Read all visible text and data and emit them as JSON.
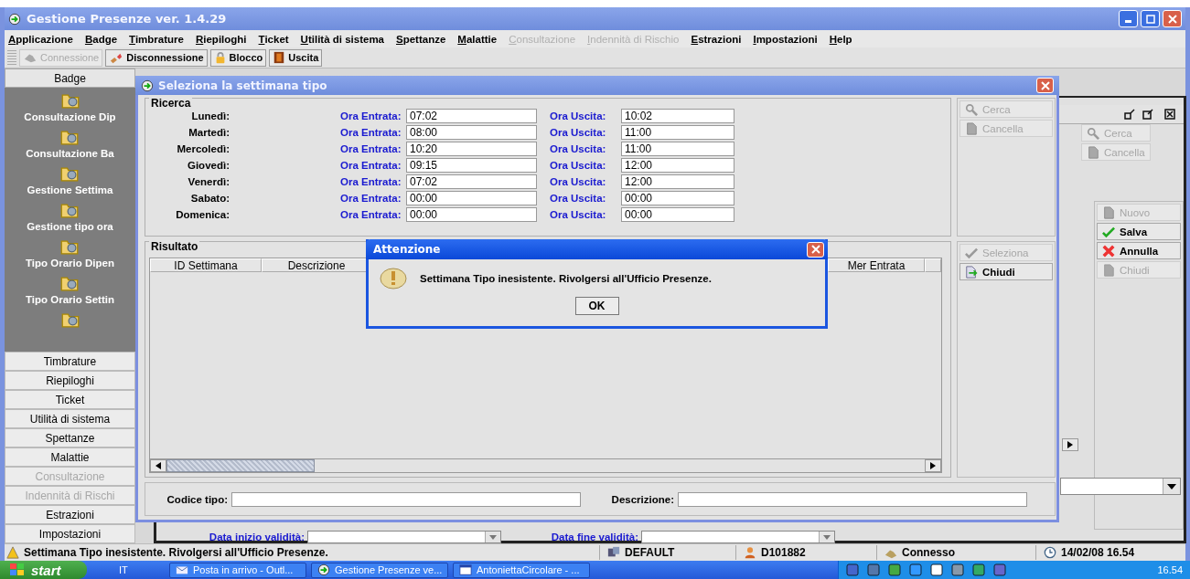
{
  "window": {
    "title": "Gestione Presenze ver. 1.4.29"
  },
  "menu": [
    {
      "label": "Applicazione",
      "disabled": false
    },
    {
      "label": "Badge",
      "disabled": false
    },
    {
      "label": "Timbrature",
      "disabled": false
    },
    {
      "label": "Riepiloghi",
      "disabled": false
    },
    {
      "label": "Ticket",
      "disabled": false
    },
    {
      "label": "Utilità di sistema",
      "disabled": false
    },
    {
      "label": "Spettanze",
      "disabled": false
    },
    {
      "label": "Malattie",
      "disabled": false
    },
    {
      "label": "Consultazione",
      "disabled": true
    },
    {
      "label": "Indennità di Rischio",
      "disabled": true
    },
    {
      "label": "Estrazioni",
      "disabled": false
    },
    {
      "label": "Impostazioni",
      "disabled": false
    },
    {
      "label": "Help",
      "disabled": false
    }
  ],
  "toolbar": [
    {
      "kind": "connect",
      "label": "Connessione",
      "disabled": true
    },
    {
      "kind": "disconnect",
      "label": "Disconnessione",
      "disabled": false
    },
    {
      "kind": "lock",
      "label": "Blocco",
      "disabled": false
    },
    {
      "kind": "exit",
      "label": "Uscita",
      "disabled": false
    }
  ],
  "sidebar": {
    "header": "Badge",
    "items": [
      "Consultazione Dip",
      "Consultazione Ba",
      "Gestione Settima",
      "Gestione tipo ora",
      "Tipo Orario Dipen",
      "Tipo Orario Settin"
    ],
    "sections": [
      {
        "label": "Timbrature",
        "disabled": false
      },
      {
        "label": "Riepiloghi",
        "disabled": false
      },
      {
        "label": "Ticket",
        "disabled": false
      },
      {
        "label": "Utilità di sistema",
        "disabled": false
      },
      {
        "label": "Spettanze",
        "disabled": false
      },
      {
        "label": "Malattie",
        "disabled": false
      },
      {
        "label": "Consultazione",
        "disabled": true
      },
      {
        "label": "Indennità di Rischi",
        "disabled": true
      },
      {
        "label": "Estrazioni",
        "disabled": false
      },
      {
        "label": "Impostazioni",
        "disabled": false
      }
    ]
  },
  "background_window": {
    "search_buttons": [
      {
        "kind": "search",
        "label": "Cerca",
        "disabled": true
      },
      {
        "kind": "clear",
        "label": "Cancella",
        "disabled": true
      }
    ],
    "action_buttons": [
      {
        "kind": "new",
        "label": "Nuovo",
        "disabled": true
      },
      {
        "kind": "save",
        "label": "Salva",
        "disabled": false
      },
      {
        "kind": "cancel",
        "label": "Annulla",
        "disabled": false
      },
      {
        "kind": "close",
        "label": "Chiudi",
        "disabled": true
      }
    ],
    "date_fields": [
      {
        "label": "Data inizio validità:"
      },
      {
        "label": "Data fine validità:"
      }
    ]
  },
  "dialog": {
    "title": "Seleziona la settimana tipo",
    "search_title": "Ricerca",
    "days": [
      {
        "day": "Lunedì:",
        "entry_label": "Ora Entrata:",
        "entry": "07:02",
        "exit_label": "Ora Uscita:",
        "exit": "10:02"
      },
      {
        "day": "Martedì:",
        "entry_label": "Ora Entrata:",
        "entry": "08:00",
        "exit_label": "Ora Uscita:",
        "exit": "11:00"
      },
      {
        "day": "Mercoledì:",
        "entry_label": "Ora Entrata:",
        "entry": "10:20",
        "exit_label": "Ora Uscita:",
        "exit": "11:00"
      },
      {
        "day": "Giovedì:",
        "entry_label": "Ora Entrata:",
        "entry": "09:15",
        "exit_label": "Ora Uscita:",
        "exit": "12:00"
      },
      {
        "day": "Venerdì:",
        "entry_label": "Ora Entrata:",
        "entry": "07:02",
        "exit_label": "Ora Uscita:",
        "exit": "12:00"
      },
      {
        "day": "Sabato:",
        "entry_label": "Ora Entrata:",
        "entry": "00:00",
        "exit_label": "Ora Uscita:",
        "exit": "00:00"
      },
      {
        "day": "Domenica:",
        "entry_label": "Ora Entrata:",
        "entry": "00:00",
        "exit_label": "Ora Uscita:",
        "exit": "00:00"
      }
    ],
    "search_buttons": [
      {
        "kind": "search",
        "label": "Cerca",
        "disabled": true
      },
      {
        "kind": "clear",
        "label": "Cancella",
        "disabled": true
      }
    ],
    "results_title": "Risultato",
    "columns": [
      "ID Settimana",
      "Descrizione",
      "Mer Entrata"
    ],
    "action_buttons": [
      {
        "kind": "select",
        "label": "Seleziona",
        "disabled": true
      },
      {
        "kind": "close",
        "label": "Chiudi",
        "disabled": false
      }
    ],
    "filters": [
      {
        "label": "Codice tipo:"
      },
      {
        "label": "Descrizione:"
      }
    ]
  },
  "alert": {
    "title": "Attenzione",
    "message": "Settimana Tipo inesistente. Rivolgersi all'Ufficio Presenze.",
    "button": "OK"
  },
  "status_bar": {
    "message": "Settimana Tipo inesistente. Rivolgersi all'Ufficio Presenze.",
    "items": [
      {
        "kind": "database",
        "text": "DEFAULT"
      },
      {
        "kind": "user",
        "text": "D101882"
      },
      {
        "kind": "connection",
        "text": "Connesso"
      },
      {
        "kind": "clock",
        "text": "14/02/08 16.54"
      }
    ]
  },
  "taskbar": {
    "start": "start",
    "language": "IT",
    "tasks": [
      {
        "kind": "mail",
        "label": "Posta in arrivo - Outl..."
      },
      {
        "kind": "app",
        "label": "Gestione Presenze ve..."
      },
      {
        "kind": "word",
        "label": "AntoniettaCircolare - ..."
      }
    ],
    "clock": "16.54"
  }
}
